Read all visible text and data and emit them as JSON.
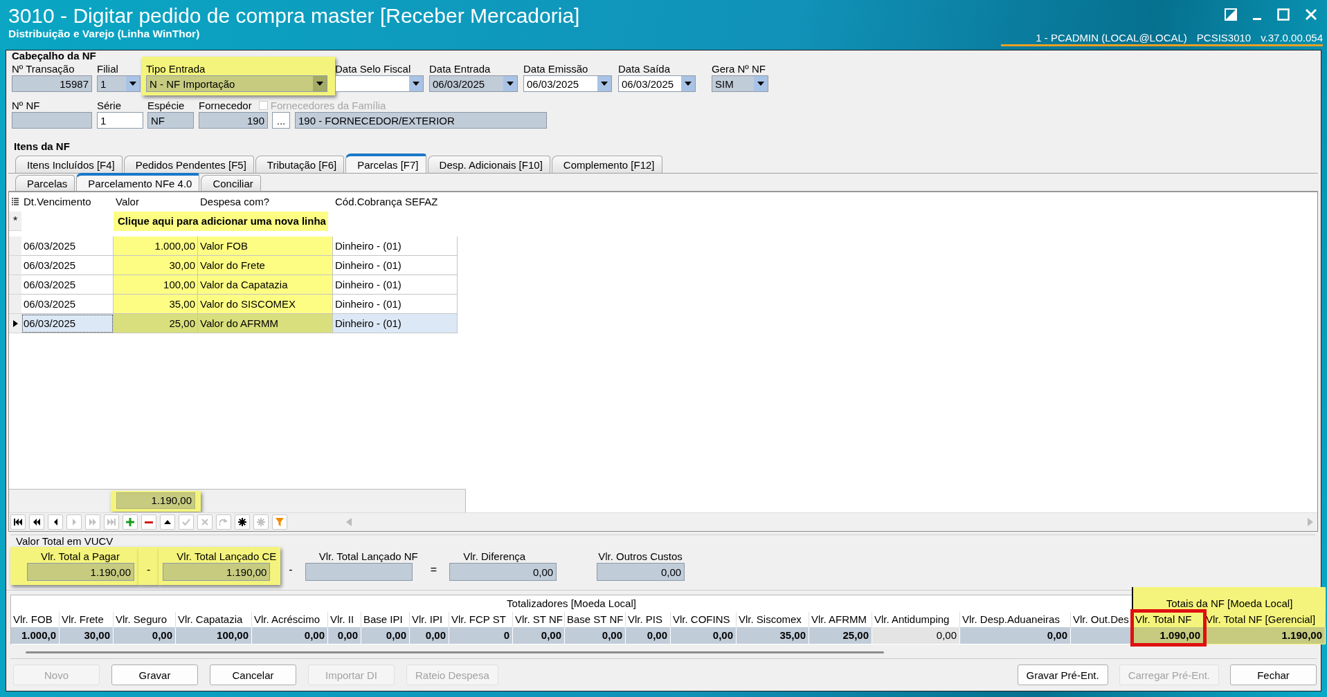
{
  "window": {
    "title": "3010 - Digitar pedido de compra master [Receber Mercadoria]",
    "subtitle": "Distribuição e Varejo (Linha WinThor)",
    "user": "1 - PCADMIN (LOCAL@LOCAL)",
    "program": "PCSIS3010",
    "version": "v.37.0.00.054"
  },
  "header": {
    "title": "Cabeçalho da NF",
    "row1": [
      {
        "label": "Nº Transação",
        "value": "15987",
        "kind": "text",
        "readonly": true,
        "highlighted": false
      },
      {
        "label": "Filial",
        "value": "1",
        "kind": "combo",
        "readonly": true,
        "highlighted": false
      },
      {
        "label": "Tipo Entrada",
        "value": "N - NF Importação",
        "kind": "combo",
        "readonly": true,
        "highlighted": true
      },
      {
        "label": "Data Selo Fiscal",
        "kind": "combo",
        "readonly": false,
        "highlighted": false
      },
      {
        "label": "Data Entrada",
        "value": "06/03/2025",
        "kind": "combo",
        "readonly": true,
        "highlighted": false
      },
      {
        "label": "Data Emissão",
        "value": "06/03/2025",
        "kind": "combo",
        "readonly": false,
        "highlighted": false
      },
      {
        "label": "Data Saída",
        "value": "06/03/2025",
        "kind": "combo",
        "readonly": false,
        "highlighted": false
      },
      {
        "label": "Gera Nº NF",
        "value": "SIM",
        "kind": "combo",
        "readonly": true,
        "highlighted": false
      }
    ],
    "row2": [
      {
        "label": "Nº NF",
        "kind": "text",
        "readonly": true,
        "highlighted": false
      },
      {
        "label": "Série",
        "value": "1",
        "kind": "text",
        "readonly": false,
        "highlighted": false
      },
      {
        "label": "Espécie",
        "value": "NF",
        "kind": "text",
        "readonly": true,
        "highlighted": false
      },
      {
        "label": "Fornecedor",
        "value": "190",
        "kind": "text",
        "readonly": true,
        "highlighted": false
      },
      {
        "value": "...",
        "kind": "button",
        "highlighted": false
      },
      {
        "value": "190 - FORNECEDOR/EXTERIOR",
        "kind": "text",
        "readonly": true,
        "highlighted": false
      }
    ],
    "family_checkbox": {
      "label": "Fornecedores da Família",
      "checked": false,
      "disabled": true
    }
  },
  "items_title": "Itens da NF",
  "tabs": [
    {
      "label": "Itens Incluídos [F4]",
      "selected": false
    },
    {
      "label": "Pedidos Pendentes [F5]",
      "selected": false
    },
    {
      "label": "Tributação [F6]",
      "selected": false
    },
    {
      "label": "Parcelas [F7]",
      "selected": true
    },
    {
      "label": "Desp. Adicionais [F10]",
      "selected": false
    },
    {
      "label": "Complemento [F12]",
      "selected": false
    }
  ],
  "subtabs": [
    {
      "label": "Parcelas",
      "selected": false
    },
    {
      "label": "Parcelamento NFe 4.0",
      "selected": true
    },
    {
      "label": "Conciliar",
      "selected": false
    }
  ],
  "grid": {
    "columns": [
      {
        "label": "Dt.Vencimento",
        "highlighted": false
      },
      {
        "label": "Valor",
        "highlighted": true
      },
      {
        "label": "Despesa com?",
        "highlighted": true
      },
      {
        "label": "Cód.Cobrança SEFAZ",
        "highlighted": false
      }
    ],
    "new_row": {
      "marker": "*",
      "text": "Clique aqui para adicionar uma nova linha"
    },
    "rows": [
      {
        "cells": [
          "06/03/2025",
          "1.000,00",
          "Valor FOB",
          "Dinheiro - (01)"
        ],
        "selected": false
      },
      {
        "cells": [
          "06/03/2025",
          "30,00",
          "Valor do Frete",
          "Dinheiro - (01)"
        ],
        "selected": false
      },
      {
        "cells": [
          "06/03/2025",
          "100,00",
          "Valor da Capatazia",
          "Dinheiro - (01)"
        ],
        "selected": false
      },
      {
        "cells": [
          "06/03/2025",
          "35,00",
          "Valor do SISCOMEX",
          "Dinheiro - (01)"
        ],
        "selected": false
      },
      {
        "cells": [
          "06/03/2025",
          "25,00",
          "Valor do AFRMM",
          "Dinheiro - (01)"
        ],
        "selected": true
      }
    ],
    "footer": {
      "total": "1.190,00",
      "highlighted": true
    },
    "navigator": [
      {
        "kind": "first",
        "disabled": false
      },
      {
        "kind": "prev-page",
        "disabled": false
      },
      {
        "kind": "prev",
        "disabled": false
      },
      {
        "kind": "next",
        "disabled": true
      },
      {
        "kind": "next-page",
        "disabled": true
      },
      {
        "kind": "last",
        "disabled": true
      },
      {
        "kind": "add",
        "disabled": false
      },
      {
        "kind": "delete",
        "disabled": false
      },
      {
        "kind": "up",
        "disabled": false
      },
      {
        "kind": "confirm",
        "disabled": true
      },
      {
        "kind": "cancel",
        "disabled": true
      },
      {
        "kind": "refresh",
        "disabled": true
      },
      {
        "kind": "star",
        "disabled": false
      },
      {
        "kind": "star",
        "disabled": true
      },
      {
        "kind": "filter",
        "disabled": false
      }
    ]
  },
  "vucv": {
    "title": "Valor Total em VUCV",
    "items": [
      {
        "kind": "field",
        "label": "Vlr. Total a Pagar",
        "value": "1.190,00",
        "highlighted": true
      },
      {
        "kind": "operator",
        "text": "-",
        "highlighted": true
      },
      {
        "kind": "field",
        "label": "Vlr. Total Lançado CE",
        "value": "1.190,00",
        "highlighted": true
      },
      {
        "kind": "operator",
        "text": "-",
        "highlighted": false
      },
      {
        "kind": "field",
        "label": "Vlr. Total Lançado NF",
        "highlighted": false
      },
      {
        "kind": "operator",
        "text": "=",
        "highlighted": false
      },
      {
        "kind": "field",
        "label": "Vlr. Diferença",
        "value": "0,00",
        "highlighted": false
      }
    ],
    "other": {
      "label": "Vlr. Outros Custos",
      "value": "0,00"
    }
  },
  "totals": {
    "groups": [
      {
        "title": "Totalizadores [Moeda Local]",
        "highlighted": false,
        "columns": [
          {
            "label": "Vlr. FOB",
            "value": "1.000,0",
            "emphasized": true,
            "outlined": false
          },
          {
            "label": "Vlr. Frete",
            "value": "30,00",
            "emphasized": true,
            "outlined": false
          },
          {
            "label": "Vlr. Seguro",
            "value": "0,00",
            "emphasized": true,
            "outlined": false
          },
          {
            "label": "Vlr. Capatazia",
            "value": "100,00",
            "emphasized": true,
            "outlined": false
          },
          {
            "label": "Vlr. Acréscimo",
            "value": "0,00",
            "emphasized": true,
            "outlined": false
          },
          {
            "label": "Vlr. II",
            "value": "0,00",
            "emphasized": true,
            "outlined": false
          },
          {
            "label": "Base IPI",
            "value": "0,00",
            "emphasized": true,
            "outlined": false
          },
          {
            "label": "Vlr. IPI",
            "value": "0,00",
            "emphasized": true,
            "outlined": false
          },
          {
            "label": "Vlr. FCP ST",
            "value": "0",
            "emphasized": true,
            "outlined": false
          },
          {
            "label": "Vlr. ST NF",
            "value": "0,00",
            "emphasized": true,
            "outlined": false
          },
          {
            "label": "Base ST NF",
            "value": "0,00",
            "emphasized": true,
            "outlined": false
          },
          {
            "label": "Vlr. PIS",
            "value": "0,00",
            "emphasized": true,
            "outlined": false
          },
          {
            "label": "Vlr. COFINS",
            "value": "0,00",
            "emphasized": true,
            "outlined": false
          },
          {
            "label": "Vlr. Siscomex",
            "value": "35,00",
            "emphasized": true,
            "outlined": false
          },
          {
            "label": "Vlr. AFRMM",
            "value": "25,00",
            "emphasized": true,
            "outlined": false
          },
          {
            "label": "Vlr. Antidumping",
            "value": "0,00",
            "emphasized": false,
            "outlined": false
          },
          {
            "label": "Vlr. Desp.Aduaneiras",
            "value": "0,00",
            "emphasized": true,
            "outlined": false
          },
          {
            "label": "Vlr. Out.Des",
            "emphasized": true,
            "outlined": false
          }
        ]
      },
      {
        "title": "Totais da NF [Moeda Local]",
        "highlighted": true,
        "columns": [
          {
            "label": "Vlr. Total NF",
            "value": "1.090,00",
            "emphasized": true,
            "outlined": true
          },
          {
            "label": "Vlr. Total NF [Gerencial]",
            "value": "1.190,00",
            "emphasized": true,
            "outlined": false
          }
        ]
      }
    ]
  },
  "buttons": {
    "left": [
      {
        "label": "Novo",
        "disabled": true
      },
      {
        "label": "Gravar",
        "disabled": false
      },
      {
        "label": "Cancelar",
        "disabled": false
      },
      {
        "label": "Importar DI",
        "disabled": true
      },
      {
        "label": "Rateio Despesa",
        "disabled": true
      }
    ],
    "right": [
      {
        "label": "Gravar Pré-Ent.",
        "disabled": false
      },
      {
        "label": "Carregar Pré-Ent.",
        "disabled": true
      },
      {
        "label": "Fechar",
        "disabled": false
      }
    ]
  }
}
